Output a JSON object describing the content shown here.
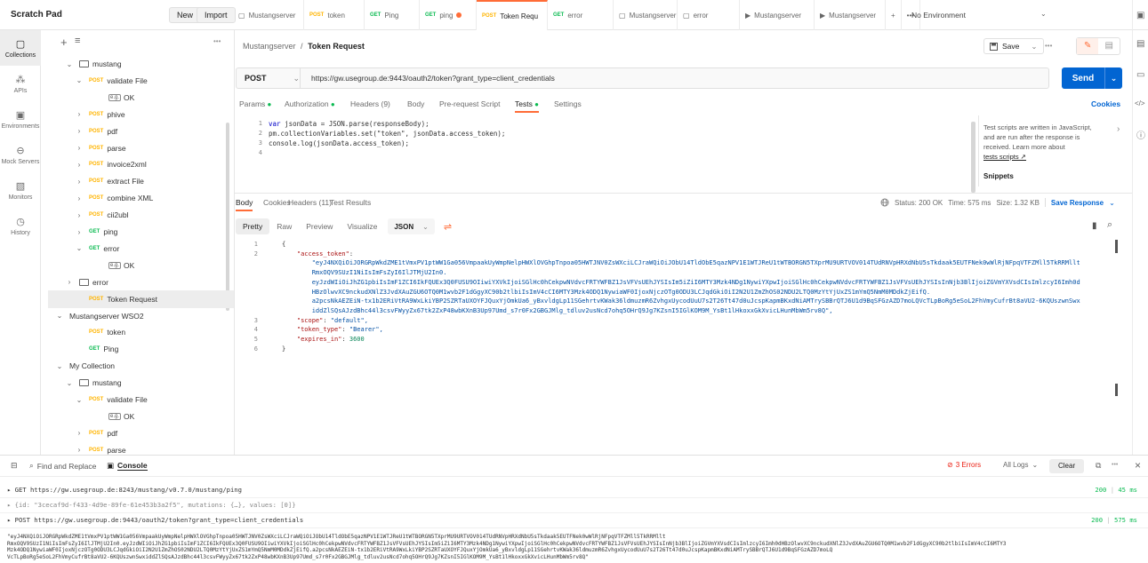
{
  "workspace": {
    "title": "Scratch Pad",
    "new_label": "New",
    "import_label": "Import"
  },
  "tabs": [
    {
      "method": "",
      "label": "Mustangserver",
      "icon": "collection-icon"
    },
    {
      "method": "POST",
      "label": "token"
    },
    {
      "method": "GET",
      "label": "Ping"
    },
    {
      "method": "GET",
      "label": "ping",
      "dirty": true
    },
    {
      "method": "POST",
      "label": "Token Requ",
      "active": true,
      "dirty": true
    },
    {
      "method": "GET",
      "label": "error"
    },
    {
      "method": "",
      "label": "Mustangserver",
      "icon": "collection-icon"
    },
    {
      "method": "",
      "label": "error",
      "icon": "folder-icon"
    },
    {
      "method": "",
      "label": "Mustangserver",
      "icon": "play-icon"
    },
    {
      "method": "",
      "label": "Mustangserver",
      "icon": "play-icon"
    }
  ],
  "environment": {
    "label": "No Environment"
  },
  "rail": [
    {
      "label": "Collections",
      "active": true
    },
    {
      "label": "APIs"
    },
    {
      "label": "Environments"
    },
    {
      "label": "Mock Servers"
    },
    {
      "label": "Monitors"
    },
    {
      "label": "History"
    }
  ],
  "sidebar": {
    "items": [
      {
        "indent": 1,
        "chev": "v",
        "type": "folder",
        "label": "mustang"
      },
      {
        "indent": 2,
        "chev": "v",
        "method": "POST",
        "label": "validate File"
      },
      {
        "indent": 4,
        "type": "example",
        "label": "OK"
      },
      {
        "indent": 2,
        "chev": ">",
        "method": "POST",
        "label": "phive"
      },
      {
        "indent": 2,
        "chev": ">",
        "method": "POST",
        "label": "pdf"
      },
      {
        "indent": 2,
        "chev": ">",
        "method": "POST",
        "label": "parse"
      },
      {
        "indent": 2,
        "chev": ">",
        "method": "POST",
        "label": "invoice2xml"
      },
      {
        "indent": 2,
        "chev": ">",
        "method": "POST",
        "label": "extract File"
      },
      {
        "indent": 2,
        "chev": ">",
        "method": "POST",
        "label": "combine XML"
      },
      {
        "indent": 2,
        "chev": ">",
        "method": "POST",
        "label": "cii2ubl"
      },
      {
        "indent": 2,
        "chev": ">",
        "method": "GET",
        "label": "ping"
      },
      {
        "indent": 2,
        "chev": "v",
        "method": "GET",
        "label": "error"
      },
      {
        "indent": 4,
        "type": "example",
        "label": "OK"
      },
      {
        "indent": 1,
        "chev": ">",
        "type": "folder",
        "label": "error"
      },
      {
        "indent": 2,
        "method": "POST",
        "label": "Token Request",
        "selected": true
      },
      {
        "indent": 0,
        "chev": "v",
        "label": "Mustangserver WSO2"
      },
      {
        "indent": 2,
        "method": "POST",
        "label": "token"
      },
      {
        "indent": 2,
        "method": "GET",
        "label": "Ping"
      },
      {
        "indent": 0,
        "chev": "v",
        "label": "My Collection"
      },
      {
        "indent": 1,
        "chev": "v",
        "type": "folder",
        "label": "mustang"
      },
      {
        "indent": 2,
        "chev": "v",
        "method": "POST",
        "label": "validate File"
      },
      {
        "indent": 4,
        "type": "example",
        "label": "OK"
      },
      {
        "indent": 2,
        "chev": ">",
        "method": "POST",
        "label": "pdf"
      },
      {
        "indent": 2,
        "chev": ">",
        "method": "POST",
        "label": "parse"
      }
    ]
  },
  "request": {
    "breadcrumb_parent": "Mustangserver",
    "breadcrumb_sep": "/",
    "breadcrumb_current": "Token Request",
    "save_label": "Save",
    "method": "POST",
    "url": "https://gw.usegroup.de:9443/oauth2/token?grant_type=client_credentials",
    "send_label": "Send",
    "tabs": [
      "Params",
      "Authorization",
      "Headers (9)",
      "Body",
      "Pre-request Script",
      "Tests",
      "Settings"
    ],
    "cookies_label": "Cookies"
  },
  "tests": {
    "lines": [
      "var jsonData = JSON.parse(responseBody);",
      "pm.collectionVariables.set(\"token\", jsonData.access_token);",
      "console.log(jsonData.access_token);",
      ""
    ],
    "help_line1": "Test scripts are written in JavaScript,",
    "help_line2": "and are run after the response is",
    "help_line3": "received. Learn more about",
    "help_link": "tests scripts ↗",
    "snippets_label": "Snippets"
  },
  "response": {
    "tabs": [
      "Body",
      "Cookies",
      "Headers (11)",
      "Test Results"
    ],
    "status": "Status: 200 OK",
    "time": "Time: 575 ms",
    "size": "Size: 1.32 KB",
    "save_label": "Save Response",
    "view_opts": [
      "Pretty",
      "Raw",
      "Preview",
      "Visualize"
    ],
    "format": "JSON",
    "line_numbers": [
      "1",
      "2",
      "",
      "",
      "",
      "",
      "",
      "",
      "3",
      "4",
      "5",
      "6"
    ],
    "lines": [
      "{",
      "    \"access_token\":",
      "        \"eyJ4NXQiOiJORGRpWkdZME1tVmxPV1ptWW1Ga056VmpaakUyWmpNelpHWXlOVGhpTnpoa05HWTJNV0ZsWXciLCJraWQiOiJObU14TldObE5qazNPV1E1WTJReU1tWTBORGN5TXprMU9URTVOV014TUdRNVpHRXdNbU5sTkdaak5EUTFNek0wWlRjNFpqVTFZMll5TkRRMllt",
      "        RmxOQV9SUzI1NiIsImFsZyI6IlJTMjU2In0.",
      "        eyJzdWIiOiJhZG1pbiIsImF1ZCI6IkFQUEx3Q0FUSU9OIiwiYXVkIjoiSGlHc0hCekpwNVdvcFRTYWFBZ1JsVFVsUEhJYSIsIm5iZiI6MTY3Mzk4NDg1NywiYXpwIjoiSGlHc0hCekpwNVdvcFRTYWFBZ1JsVFVsUEhJYSIsInNjb3BlIjoiZGVmYXVsdCIsImlzcyI6Imh0d",
      "        HBzOlwvXC9nckudXNlZ3JvdXAuZGU6OTQ0M1wvb2F1dGgyXC90b2tlbiIsImV4cCI6MTY3Mzk4ODQ1NywiaWF0IjoxNjczOTg0ODU3LCJqdGkiOiI2N2U1ZmZhOS02NDU2LTQ0MzYtYjUxZS1mYmQ5NmM0MDdkZjEifQ.",
      "        a2pcsNkAEZEiN-tx1b2ERiVtRA9WxLkiYBP2SZRTaUXOYFJQuxYjOmkUa6_yBxvldgLp11SGehrtvKWak36ldmuzmR6ZvhgxUycodUuU7s2T26Tt47d0uJcspKapmBKxdNiAMTrySBBrQTJ6U1d9BqSFGzAZD7moLQVcTLpBoRg5eSoL2FhVmyCufrBt8aVU2-6KQUszwnSwx",
      "        iddZlSQsAJzdBhc44l3csvFWyyZx67tk2ZxP48wbKXnB3Up97Umd_s7r0Fx2GBGJMlg_tdluv2usNcd7ohq5OHrQ9Jg7KZsnI5IGlKOM9M_YsBt1lHkoxxGkXvicLHunMbWm5rv8Q\",",
      "    \"scope\": \"default\",",
      "    \"token_type\": \"Bearer\",",
      "    \"expires_in\": 3600",
      "}"
    ]
  },
  "console": {
    "find_label": "Find and Replace",
    "console_label": "Console",
    "errors_label": "3 Errors",
    "logs_label": "All Logs",
    "clear_label": "Clear",
    "entries": [
      {
        "text": "▸ GET https://gw.usegroup.de:8243/mustang/v0.7.0/mustang/ping",
        "status": "200",
        "time": "45 ms"
      },
      {
        "text": "▸ {id: \"3cecaf9d-f433-4d9e-89fe-61e453b3a2f5\", mutations: {…}, values: [0]}",
        "status": "",
        "time": ""
      },
      {
        "text": "▸ POST https://gw.usegroup.de:9443/oauth2/token?grant_type=client_credentials",
        "status": "200",
        "time": "575 ms"
      }
    ],
    "token_lines": [
      "\"eyJ4NXQiOiJORGRpWkdZME1tVmxPV1ptWW1Ga056VmpaakUyWmpNelpHWXlOVGhpTnpoa05HWTJNV0ZsWXciLCJraWQiOiJObU14TldObE5qazNPV1E1WTJReU1tWTBORGN5TXprMU9URTVOV014TUdRNVpHRXdNbU5sTkdaak5EUTFNek0wWlRjNFpqVTFZMll5TkRRMllt",
      "RmxOQV9SUzI1NiIsImFsZyI6IlJTMjU2In0.eyJzdWIiOiJhZG1pbiIsImF1ZCI6IkFQUEx3Q0FUSU9OIiwiYXVkIjoiSGlHc0hCekpwNVdvcFRTYWFBZ1JsVFVsUEhJYSIsIm5iZiI6MTY3Mzk4NDg1NywiYXpwIjoiSGlHc0hCekpwNVdvcFRTYWFBZ1JsVFVsUEhJYSIsInNjb3BlIjoiZGVmYXVsdCIsImlzcyI6Imh0dHBzOlwvXC9nckudXNlZ3JvdXAuZGU6OTQ0M1wvb2F1dGgyXC90b2tlbiIsImV4cCI6MTY3",
      "Mzk4ODQ1NywiaWF0IjoxNjczOTg0ODU3LCJqdGkiOiI2N2U1ZmZhOS02NDU2LTQ0MzYtYjUxZS1mYmQ5NmM0MDdkZjEifQ.a2pcsNkAEZEiN-tx1b2ERiVtRA9WxLkiYBP2SZRTaUXOYFJQuxYjOmkUa6_yBxvldgLp11SGehrtvKWak36ldmuzmR6ZvhgxUycodUuU7s2T26Tt47d0uJcspKapmBKxdNiAMTrySBBrQTJ6U1d9BqSFGzAZD7moLQ",
      "VcTLpBoRg5eSoL2FhVmyCufrBt8aVU2-6KQUszwnSwxiddZlSQsAJzdBhc44l3csvFWyyZx67tk2ZxP48wbKXnB3Up97Umd_s7r0Fx2GBGJMlg_tdluv2usNcd7ohq5OHrQ9Jg7KZsnI5IGlKOM9M_YsBt1lHkoxxGkXvicLHunMbWm5rv8Q\""
    ]
  },
  "colors": {
    "accent": "#ff6c37",
    "send": "#0265d2",
    "post": "#ffb400",
    "get": "#0cbb52",
    "error": "#eb2013"
  }
}
